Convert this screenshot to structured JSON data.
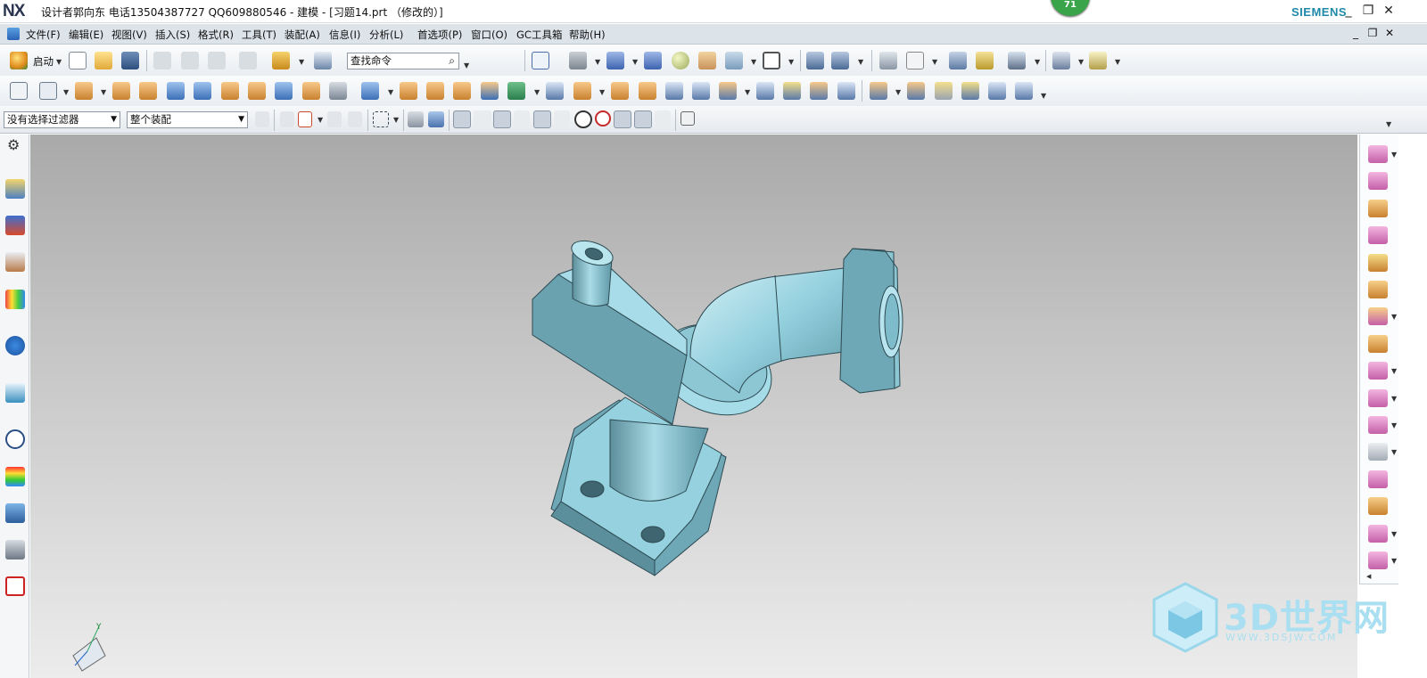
{
  "titlebar": {
    "logo": "NX",
    "title": "设计者郭向东  电话13504387727  QQ609880546 - 建模 - [习题14.prt （修改的）]",
    "badge": "71",
    "brand": "SIEMENS",
    "minimize": "_",
    "restore": "❐",
    "close": "✕"
  },
  "menubar": {
    "items": [
      "文件(F)",
      "编辑(E)",
      "视图(V)",
      "插入(S)",
      "格式(R)",
      "工具(T)",
      "装配(A)",
      "信息(I)",
      "分析(L)",
      "首选项(P)",
      "窗口(O)",
      "GC工具箱",
      "帮助(H)"
    ]
  },
  "toolbar1": {
    "start_label": "启动",
    "search_placeholder": "查找命令"
  },
  "selectionbar": {
    "filter": "没有选择过滤器",
    "scope": "整个装配"
  },
  "watermark": {
    "text": "3D世界网",
    "url": "WWW.3DSJW.COM"
  },
  "colors": {
    "part": "#8fcad8",
    "part_dark": "#5e97a6",
    "part_light": "#bfe6ef",
    "menubar": "#dce3e9"
  }
}
